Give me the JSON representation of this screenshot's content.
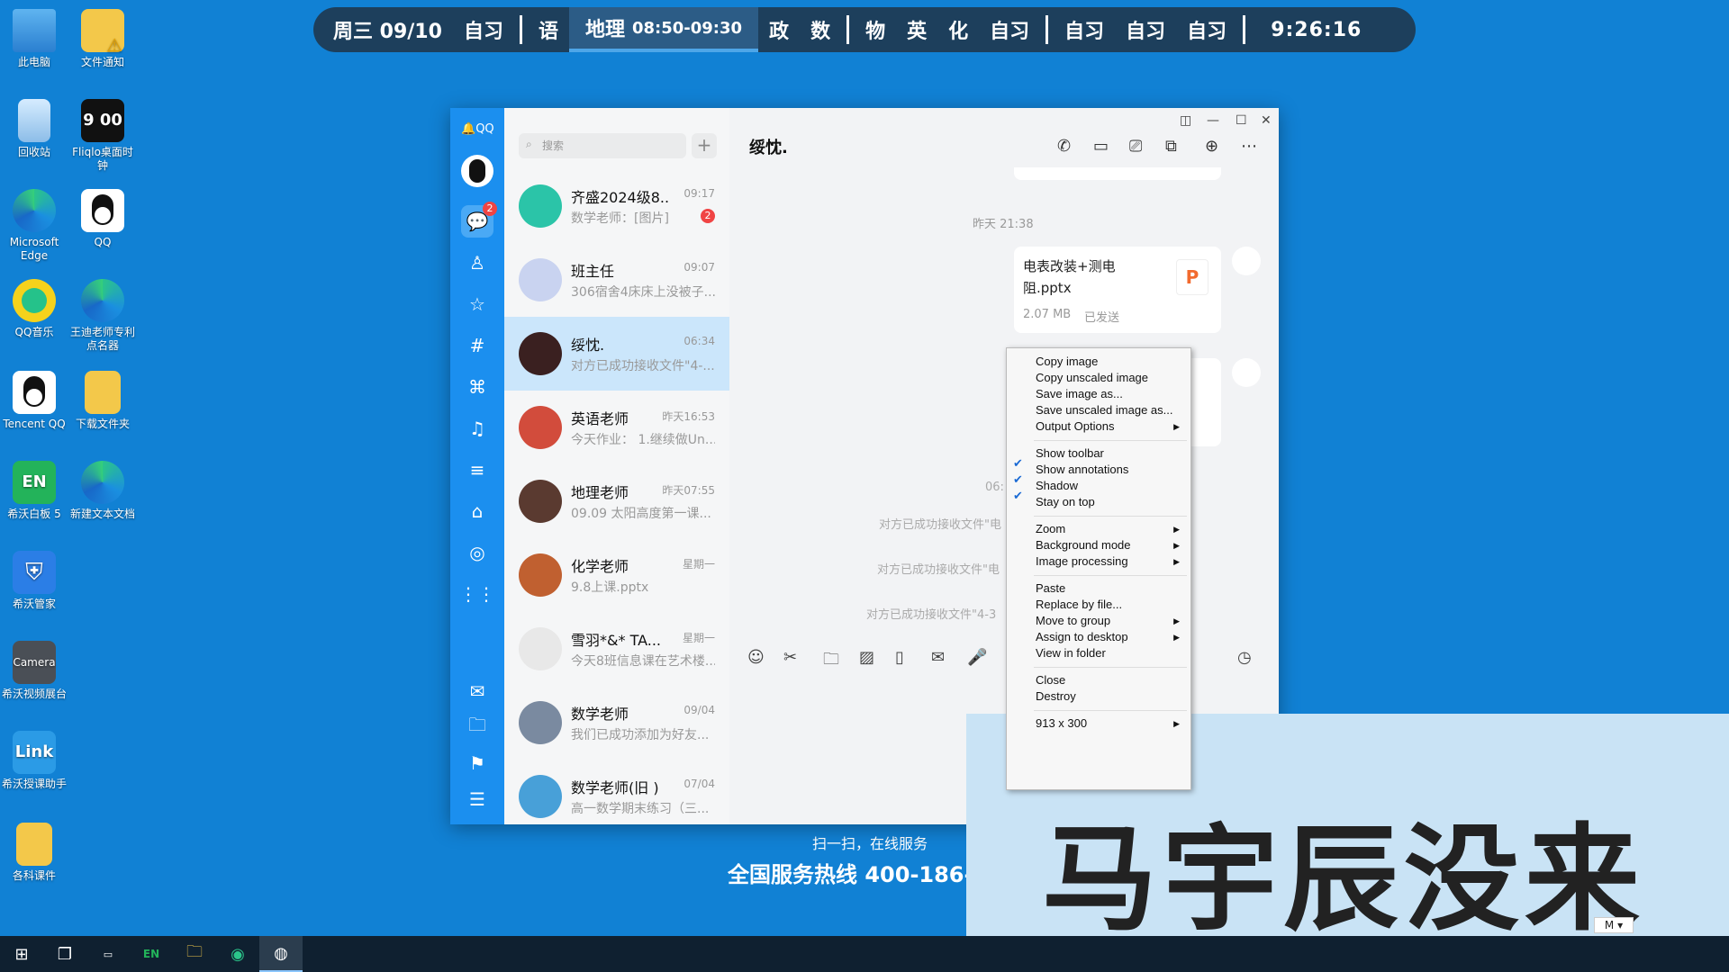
{
  "desktop_icons": [
    {
      "label": "此电脑",
      "icon": "computer-icon"
    },
    {
      "label": "文件通知",
      "icon": "folder-warning-icon"
    },
    {
      "label": "回收站",
      "icon": "recycle-bin-icon"
    },
    {
      "label": "Fliqlo桌面时钟",
      "icon": "clock-icon"
    },
    {
      "label": "Microsoft Edge",
      "icon": "edge-icon"
    },
    {
      "label": "QQ",
      "icon": "qq-icon"
    },
    {
      "label": "QQ音乐",
      "icon": "qq-music-icon"
    },
    {
      "label": "王迪老师专利点名器",
      "icon": "edge-icon"
    },
    {
      "label": "Tencent QQ",
      "icon": "qq-icon"
    },
    {
      "label": "下载文件夹",
      "icon": "folder-icon"
    },
    {
      "label": "希沃白板 5",
      "icon": "seewo-whiteboard-icon"
    },
    {
      "label": "新建文本文档",
      "icon": "edge-icon"
    },
    {
      "label": "希沃管家",
      "icon": "shield-icon"
    },
    {
      "label": "希沃视频展台",
      "icon": "camera-icon"
    },
    {
      "label": "希沃授课助手",
      "icon": "link-icon"
    },
    {
      "label": "各科课件",
      "icon": "folder-icon"
    }
  ],
  "schedule": {
    "day": "周三 09/10",
    "p1": "自习",
    "p2": "语",
    "current": "地理",
    "current_time": "08:50-09:30",
    "p4": "政",
    "p5": "数",
    "p6": "物",
    "p7": "英",
    "p8": "化",
    "p9": "自习",
    "p10": "自习",
    "p11": "自习",
    "p12": "自习",
    "clock": "9:26:16"
  },
  "qq": {
    "logo": "QQ",
    "search_placeholder": "搜索",
    "unread_badge": "2",
    "chat_title": "绥忱.",
    "chats": [
      {
        "name": "齐盛2024级8...",
        "time": "09:17",
        "preview": "数学老师：[图片]",
        "badge": "2",
        "color": "#2bc4a8"
      },
      {
        "name": "班主任",
        "time": "09:07",
        "preview": "306宿舍4床床上没被子...",
        "color": "#c9d3f0"
      },
      {
        "name": "绥忱.",
        "time": "06:34",
        "preview": "对方已成功接收文件\"4-...",
        "color": "#3a2020"
      },
      {
        "name": "英语老师",
        "time": "昨天16:53",
        "preview": "今天作业： 1.继续做Un...",
        "color": "#d24c3c"
      },
      {
        "name": "地理老师",
        "time": "昨天07:55",
        "preview": "09.09 太阳高度第一课...",
        "color": "#5a3a30"
      },
      {
        "name": "化学老师",
        "time": "星期一",
        "preview": "9.8上课.pptx",
        "color": "#c06030"
      },
      {
        "name": "雪羽*&* TA...",
        "time": "星期一",
        "preview": "今天8班信息课在艺术楼...",
        "color": "#e8e8e8"
      },
      {
        "name": "数学老师",
        "time": "09/04",
        "preview": "我们已成功添加为好友...",
        "color": "#7a8aa0"
      },
      {
        "name": "数学老师(旧 )",
        "time": "07/04",
        "preview": "高一数学期末练习（三...",
        "color": "#48a0d8"
      }
    ],
    "timestamp": "昨天 21:38",
    "file_name": "电表改装+测电阻.pptx",
    "file_size": "2.07 MB",
    "file_status": "已发送",
    "partial_time": "06:",
    "sys_msgs": [
      "对方已成功接收文件\"电",
      "对方已成功接收文件\"电",
      "对方已成功接收文件\"4-3"
    ]
  },
  "ad": {
    "line1": "扫一扫，在线服务",
    "line2": "全国服务热线 400-186-25"
  },
  "preview": {
    "text": "马宇辰没来",
    "mode": "M"
  },
  "menu": {
    "copy_image": "Copy image",
    "copy_unscaled": "Copy unscaled image",
    "save_image": "Save image as...",
    "save_unscaled": "Save unscaled image as...",
    "output_options": "Output Options",
    "show_toolbar": "Show toolbar",
    "show_annotations": "Show annotations",
    "shadow": "Shadow",
    "stay_on_top": "Stay on top",
    "zoom": "Zoom",
    "background_mode": "Background mode",
    "image_processing": "Image processing",
    "paste": "Paste",
    "replace_by_file": "Replace by file...",
    "move_to_group": "Move to group",
    "assign_to_desktop": "Assign to desktop",
    "view_in_folder": "View in folder",
    "close": "Close",
    "destroy": "Destroy",
    "size": "913 x 300"
  }
}
